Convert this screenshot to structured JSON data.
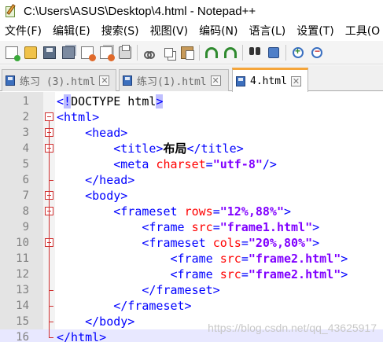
{
  "window": {
    "title": "C:\\Users\\ASUS\\Desktop\\4.html - Notepad++"
  },
  "menu": [
    {
      "label": "文件(F)"
    },
    {
      "label": "编辑(E)"
    },
    {
      "label": "搜索(S)"
    },
    {
      "label": "视图(V)"
    },
    {
      "label": "编码(N)"
    },
    {
      "label": "语言(L)"
    },
    {
      "label": "设置(T)"
    },
    {
      "label": "工具(O"
    }
  ],
  "toolbar": {
    "icons": [
      "new-file-icon",
      "open-file-icon",
      "save-icon",
      "save-all-icon",
      "close-icon",
      "close-all-icon",
      "print-icon",
      "cut-icon",
      "copy-icon",
      "paste-icon",
      "undo-icon",
      "redo-icon",
      "find-icon",
      "replace-icon",
      "zoom-in-icon",
      "zoom-out-icon"
    ]
  },
  "tabs": [
    {
      "label": "练习 (3).html",
      "active": false
    },
    {
      "label": "练习(1).html",
      "active": false
    },
    {
      "label": "4.html",
      "active": true
    }
  ],
  "editor": {
    "current_line": 16,
    "lines": [
      {
        "num": "1",
        "segs": [
          [
            "t",
            "<"
          ],
          [
            "bm",
            "!"
          ],
          [
            "dt",
            "DOCTYPE html"
          ],
          [
            "bm",
            ">"
          ]
        ]
      },
      {
        "num": "2",
        "segs": [
          [
            "t",
            "<html>"
          ]
        ]
      },
      {
        "num": "3",
        "segs": [
          [
            "t",
            "    <head>"
          ]
        ]
      },
      {
        "num": "4",
        "segs": [
          [
            "t",
            "        <title>"
          ],
          [
            "txt",
            "布局"
          ],
          [
            "t",
            "</title>"
          ]
        ]
      },
      {
        "num": "5",
        "segs": [
          [
            "t",
            "        <meta "
          ],
          [
            "a",
            "charset"
          ],
          [
            "t",
            "="
          ],
          [
            "v",
            "\"utf-8\""
          ],
          [
            "t",
            "/>"
          ]
        ]
      },
      {
        "num": "6",
        "segs": [
          [
            "t",
            "    </head>"
          ]
        ]
      },
      {
        "num": "7",
        "segs": [
          [
            "t",
            "    <body>"
          ]
        ]
      },
      {
        "num": "8",
        "segs": [
          [
            "t",
            "        <frameset "
          ],
          [
            "a",
            "rows"
          ],
          [
            "t",
            "="
          ],
          [
            "v",
            "\"12%,88%\""
          ],
          [
            "t",
            ">"
          ]
        ]
      },
      {
        "num": "9",
        "segs": [
          [
            "t",
            "            <frame "
          ],
          [
            "a",
            "src"
          ],
          [
            "t",
            "="
          ],
          [
            "v",
            "\"frame1.html\""
          ],
          [
            "t",
            ">"
          ]
        ]
      },
      {
        "num": "10",
        "segs": [
          [
            "t",
            "            <frameset "
          ],
          [
            "a",
            "cols"
          ],
          [
            "t",
            "="
          ],
          [
            "v",
            "\"20%,80%\""
          ],
          [
            "t",
            ">"
          ]
        ]
      },
      {
        "num": "11",
        "segs": [
          [
            "t",
            "                <frame "
          ],
          [
            "a",
            "src"
          ],
          [
            "t",
            "="
          ],
          [
            "v",
            "\"frame2.html\""
          ],
          [
            "t",
            ">"
          ]
        ]
      },
      {
        "num": "12",
        "segs": [
          [
            "t",
            "                <frame "
          ],
          [
            "a",
            "src"
          ],
          [
            "t",
            "="
          ],
          [
            "v",
            "\"frame2.html\""
          ],
          [
            "t",
            ">"
          ]
        ]
      },
      {
        "num": "13",
        "segs": [
          [
            "t",
            "            </frameset>"
          ]
        ]
      },
      {
        "num": "14",
        "segs": [
          [
            "t",
            "        </frameset>"
          ]
        ]
      },
      {
        "num": "15",
        "segs": [
          [
            "t",
            "    </body>"
          ]
        ]
      },
      {
        "num": "16",
        "segs": [
          [
            "t",
            "</html>"
          ]
        ]
      }
    ]
  },
  "watermark": "https://blog.csdn.net/qq_43625917"
}
